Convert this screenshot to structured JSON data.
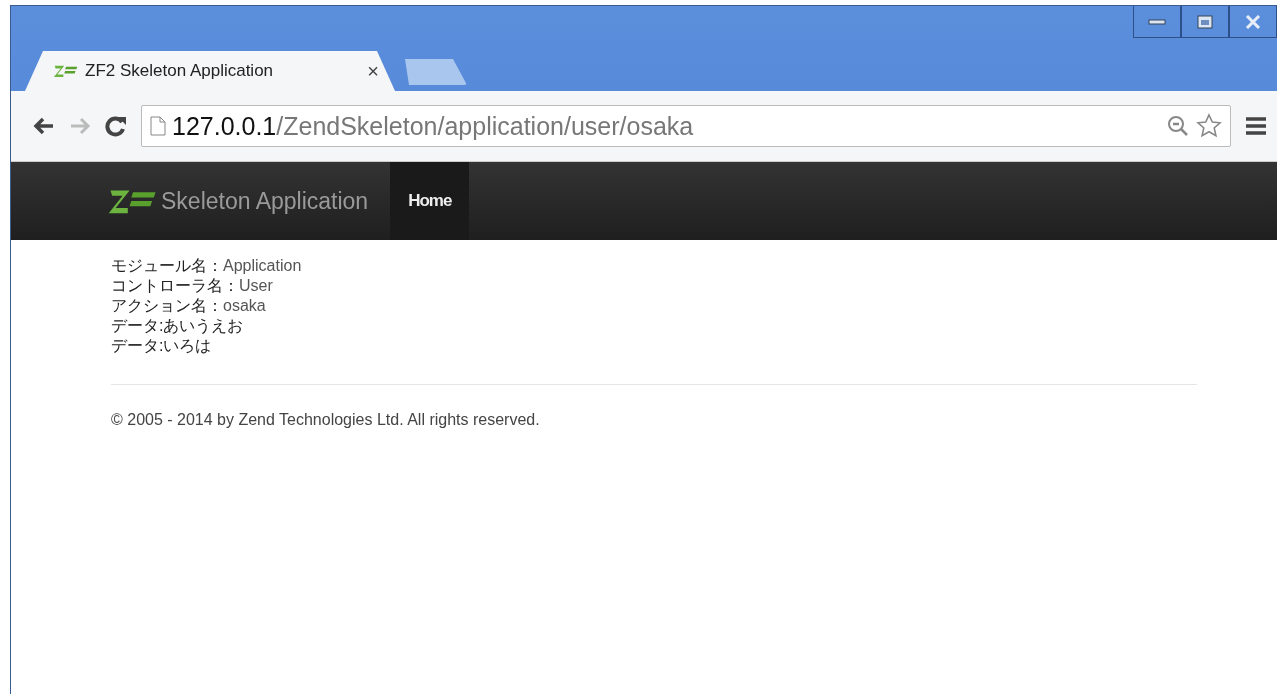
{
  "window": {
    "tabs": [
      {
        "title": "ZF2 Skeleton Application",
        "close": "×",
        "selected": true
      },
      {
        "selected": false
      }
    ]
  },
  "toolbar": {
    "url_host": "127.0.0.1",
    "url_path": "/ZendSkeleton/application/user/osaka"
  },
  "navbar": {
    "brand": "Skeleton Application",
    "items": [
      {
        "label": "Home",
        "selected": true
      }
    ]
  },
  "content": {
    "fields": [
      {
        "label": "モジュール名：",
        "value": "Application"
      },
      {
        "label": "コントローラ名：",
        "value": "User"
      },
      {
        "label": "アクション名：",
        "value": "osaka"
      }
    ],
    "lines": [
      "データ:あいうえお",
      "データ:いろは"
    ]
  },
  "footer": "© 2005 - 2014 by Zend Technologies Ltd. All rights reserved."
}
